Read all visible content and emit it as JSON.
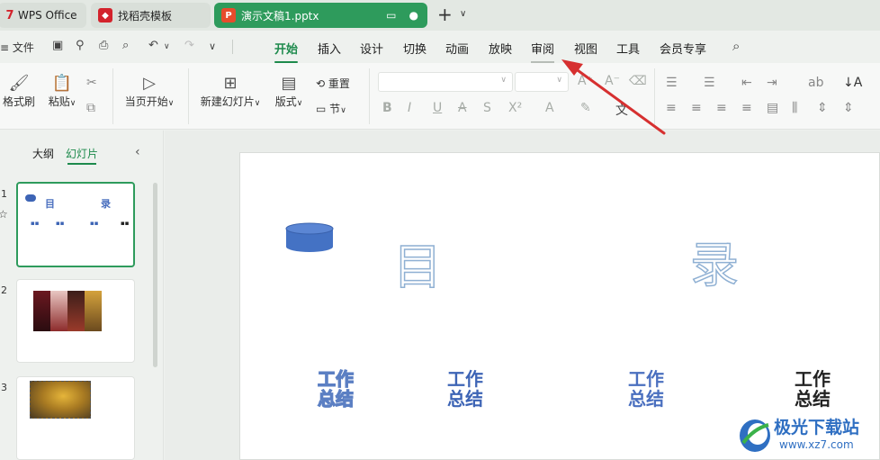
{
  "tabs": {
    "wps": {
      "label": "WPS Office"
    },
    "template": {
      "label": "找稻壳模板"
    },
    "doc": {
      "label": "演示文稿1.pptx"
    }
  },
  "menu": {
    "file": "文件",
    "tabs": [
      "开始",
      "插入",
      "设计",
      "切换",
      "动画",
      "放映",
      "审阅",
      "视图",
      "工具",
      "会员专享"
    ],
    "active": "开始"
  },
  "ribbon": {
    "format_painter": "格式刷",
    "paste": "粘贴",
    "play_current": "当页开始",
    "new_slide": "新建幻灯片",
    "layout": "版式",
    "reset": "重置",
    "section": "节"
  },
  "left_panel": {
    "tab_outline": "大纲",
    "tab_slides": "幻灯片",
    "slides": [
      {
        "num": "1",
        "title_a": "目",
        "title_b": "录"
      },
      {
        "num": "2"
      },
      {
        "num": "3"
      }
    ]
  },
  "slide": {
    "char_a": "目",
    "char_b": "录",
    "wordart_line1": "工作",
    "wordart_line2": "总结"
  },
  "watermark": {
    "title": "极光下载站",
    "url": "www.xz7.com"
  },
  "colors": {
    "accent": "#2e9b5c",
    "arrow": "#d63030",
    "wordart_blue": "#3d64b5"
  }
}
